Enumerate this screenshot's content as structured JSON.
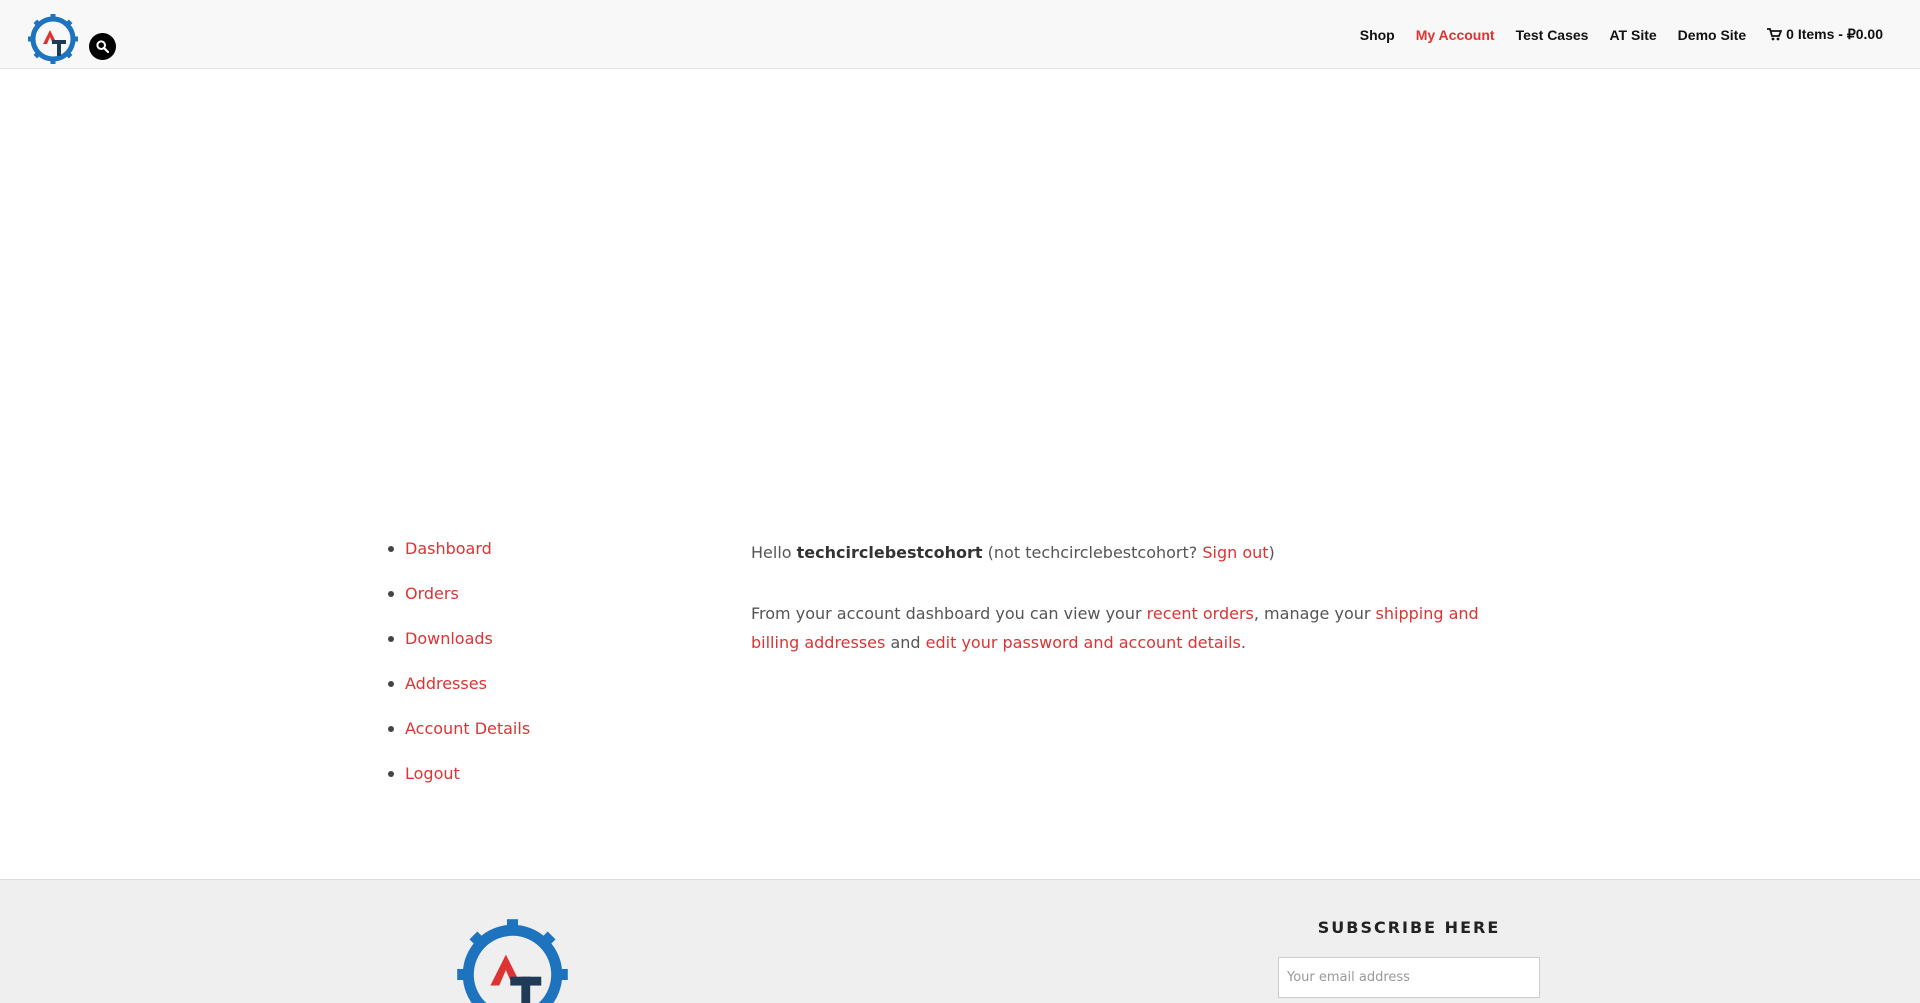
{
  "header": {
    "logo_alt": "AT",
    "nav": [
      {
        "label": "Shop"
      },
      {
        "label": "My Account"
      },
      {
        "label": "Test Cases"
      },
      {
        "label": "AT Site"
      },
      {
        "label": "Demo Site"
      }
    ],
    "cart_label": "0 Items - ₽0.00"
  },
  "account": {
    "menu": [
      {
        "label": "Dashboard"
      },
      {
        "label": "Orders"
      },
      {
        "label": "Downloads"
      },
      {
        "label": "Addresses"
      },
      {
        "label": "Account Details"
      },
      {
        "label": "Logout"
      }
    ],
    "greeting": {
      "hello": "Hello ",
      "username": "techcirclebestcohort",
      "not_prefix": " (not techcirclebestcohort? ",
      "signout": "Sign out",
      "close": ")"
    },
    "dashboard_text": {
      "part1": "From your account dashboard you can view your ",
      "recent_orders": "recent orders",
      "part2": ", manage your ",
      "addresses_link": "shipping and billing addresses",
      "part3": " and ",
      "account_link": "edit your password and account details",
      "part4": "."
    }
  },
  "footer": {
    "subscribe_title": "SUBSCRIBE HERE",
    "email_placeholder": "Your email address"
  },
  "colors": {
    "accent": "#dd3333",
    "logo_blue": "#1e73be",
    "logo_dark": "#1f3b57"
  }
}
